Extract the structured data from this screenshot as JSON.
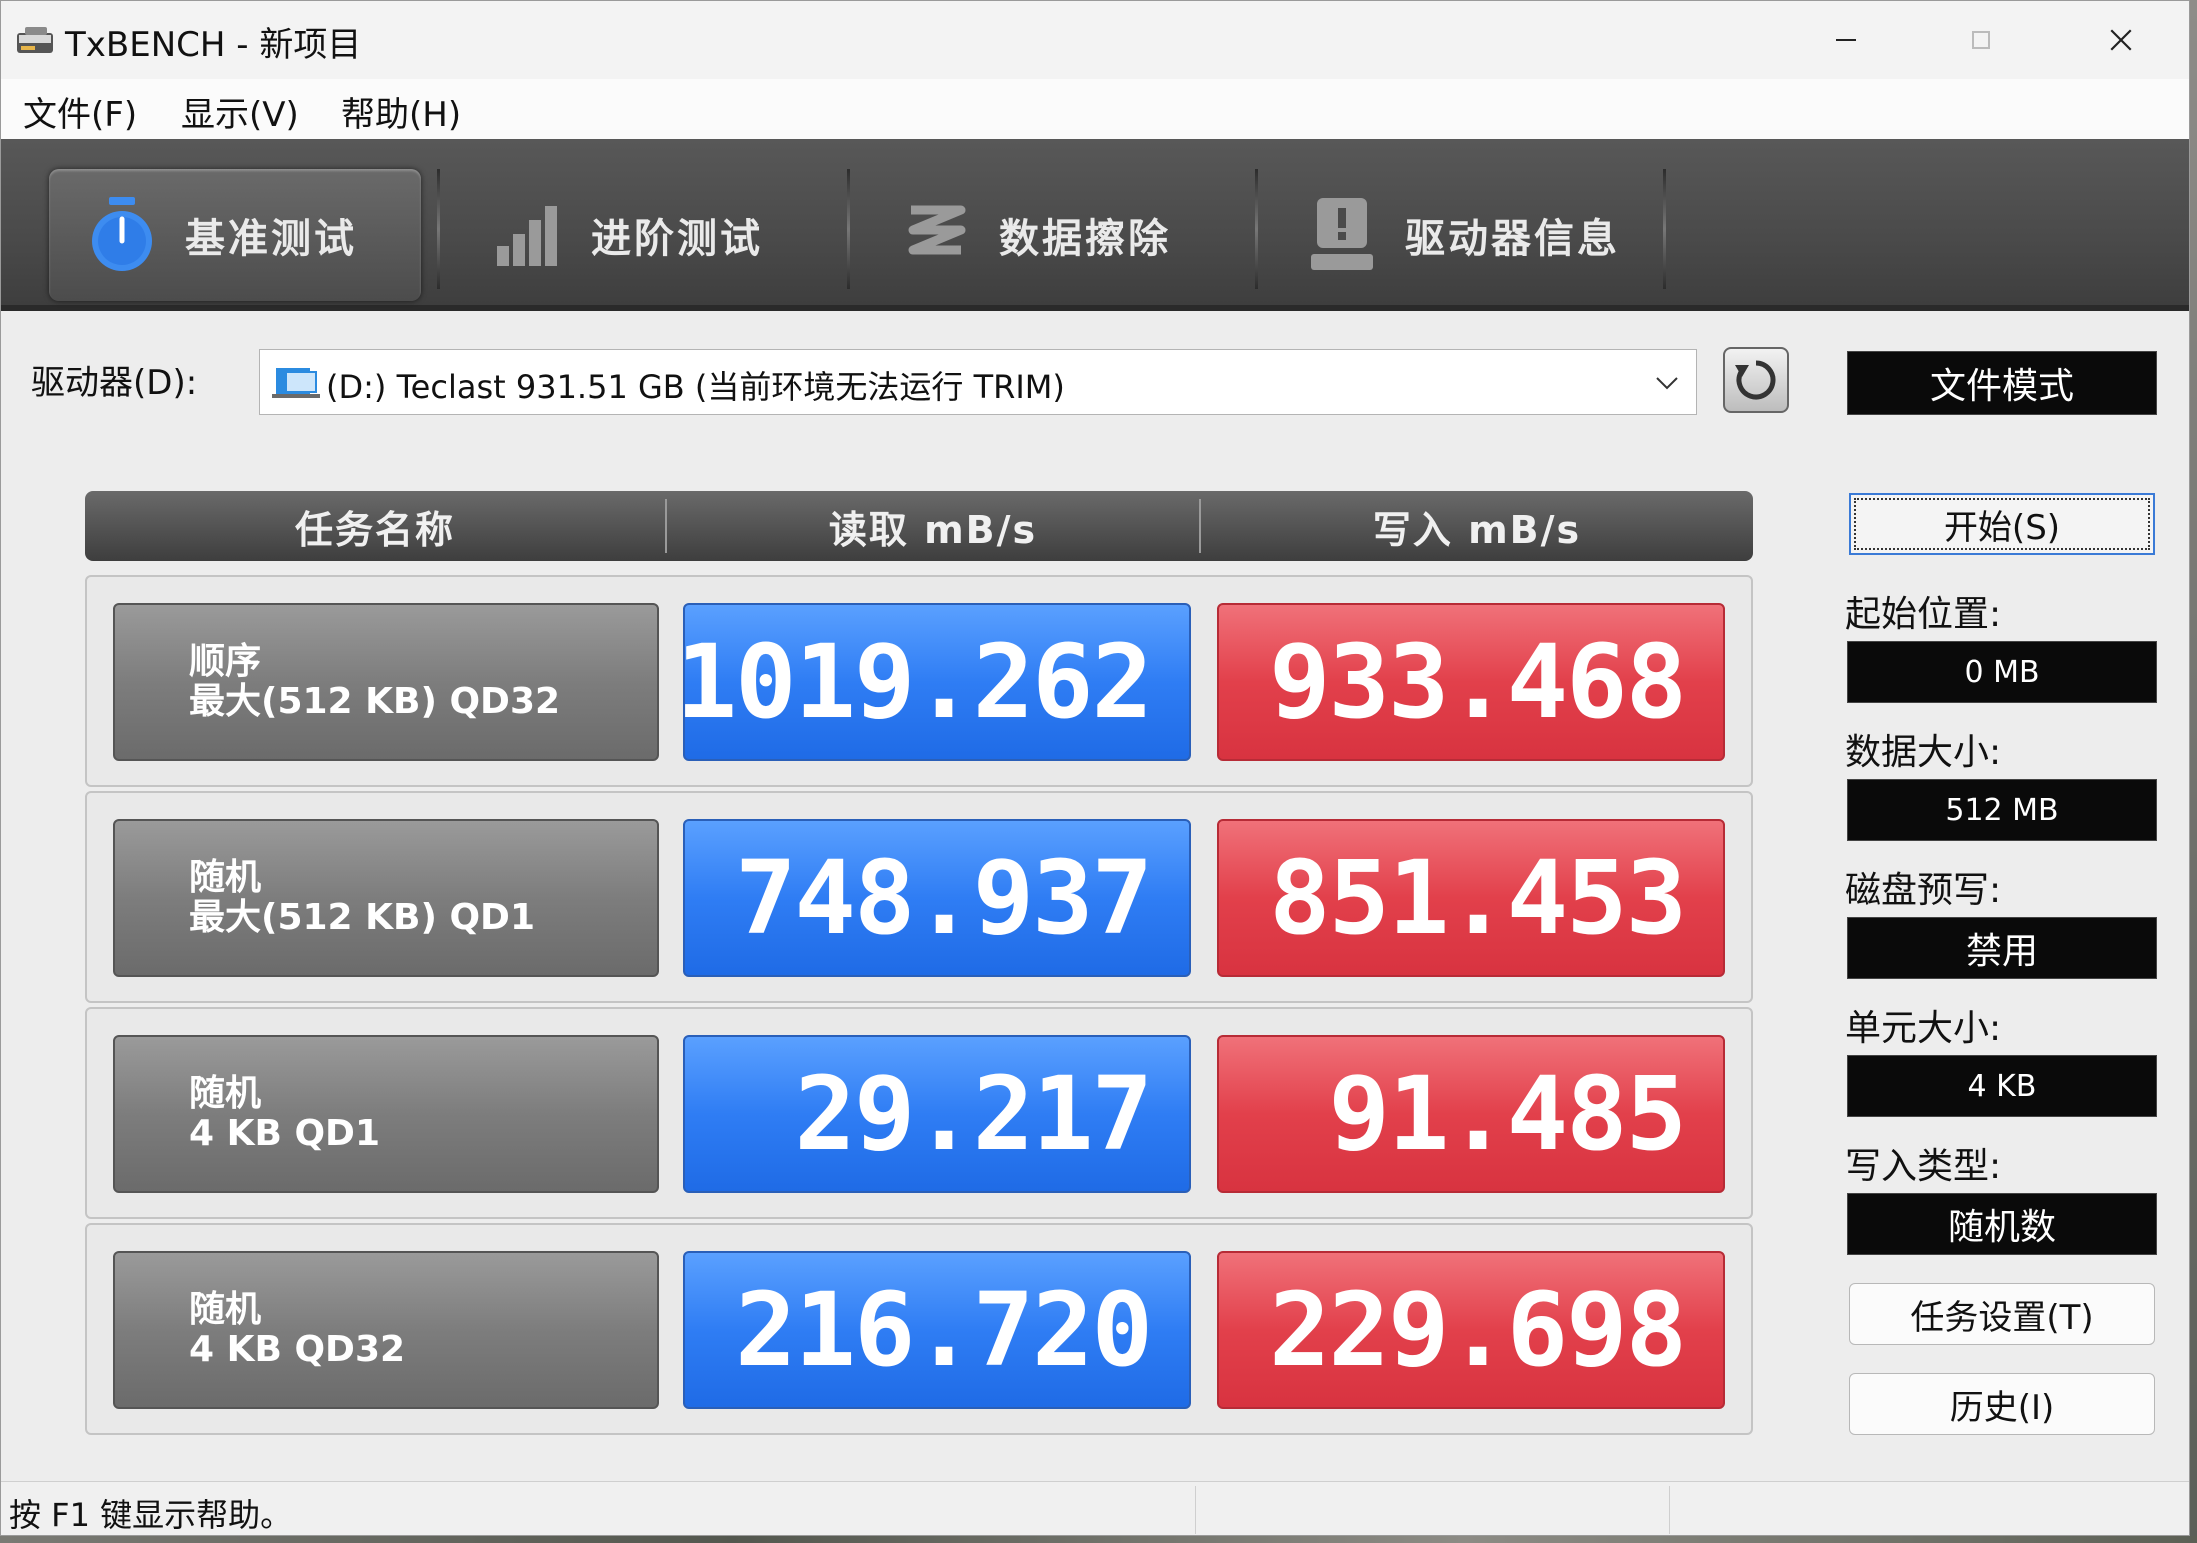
{
  "window": {
    "title": "TxBENCH - 新项目",
    "controls": [
      "minimize-icon",
      "maximize-icon",
      "close-icon"
    ]
  },
  "menu": {
    "file": "文件(F)",
    "view": "显示(V)",
    "help": "帮助(H)"
  },
  "tabs": [
    {
      "label": "基准测试",
      "icon": "stopwatch-icon",
      "active": true
    },
    {
      "label": "进阶测试",
      "icon": "bar-chart-icon",
      "active": false
    },
    {
      "label": "数据擦除",
      "icon": "erase-icon",
      "active": false
    },
    {
      "label": "驱动器信息",
      "icon": "drive-info-icon",
      "active": false
    }
  ],
  "drive": {
    "label": "驱动器(D):",
    "selected": "(D:) Teclast  931.51 GB (当前环境无法运行 TRIM)",
    "file_mode": "文件模式"
  },
  "table": {
    "headers": {
      "name": "任务名称",
      "read": "读取 mB/s",
      "write": "写入 mB/s"
    },
    "rows": [
      {
        "name_line1": "顺序",
        "name_line2": "最大(512 KB) QD32",
        "read": "1019.262",
        "write": "933.468"
      },
      {
        "name_line1": "随机",
        "name_line2": "最大(512 KB) QD1",
        "read": "748.937",
        "write": "851.453"
      },
      {
        "name_line1": "随机",
        "name_line2": "4 KB QD1",
        "read": "29.217",
        "write": "91.485"
      },
      {
        "name_line1": "随机",
        "name_line2": "4 KB QD32",
        "read": "216.720",
        "write": "229.698"
      }
    ]
  },
  "settings": {
    "start_button": "开始(S)",
    "start_position_label": "起始位置:",
    "start_position_value": "0 MB",
    "data_size_label": "数据大小:",
    "data_size_value": "512 MB",
    "precondition_label": "磁盘预写:",
    "precondition_value": "禁用",
    "cell_size_label": "单元大小:",
    "cell_size_value": "4 KB",
    "write_type_label": "写入类型:",
    "write_type_value": "随机数",
    "task_settings_button": "任务设置(T)",
    "history_button": "历史(I)"
  },
  "status": {
    "text": "按 F1 键显示帮助。"
  },
  "colors": {
    "read_accent": "#2f7df4",
    "write_accent": "#e2404b",
    "toolbar": "#4a4a4a"
  }
}
